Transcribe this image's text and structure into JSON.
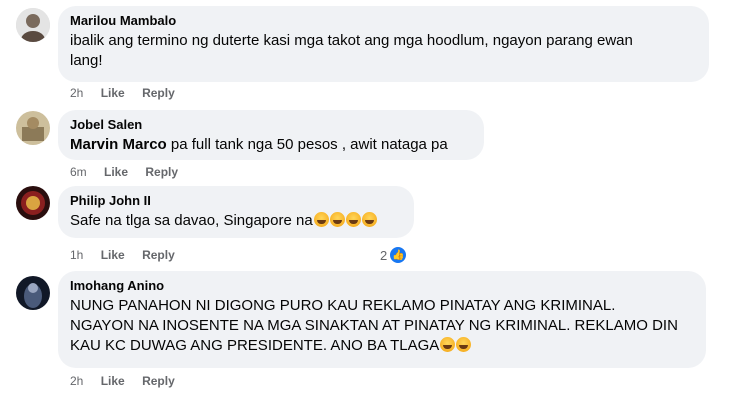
{
  "comments": [
    {
      "author": "Marilou Mambalo",
      "text_line1": "ibalik ang termino ng duterte kasi mga takot ang mga hoodlum, ngayon parang ewan",
      "text_line2": "lang!",
      "time": "2h",
      "like": "Like",
      "reply": "Reply",
      "avatar_color": "#c9c9c9"
    },
    {
      "author": "Jobel Salen",
      "mention": "Marvin Marco",
      "text": " pa full tank nga 50 pesos , awit nataga pa",
      "time": "6m",
      "like": "Like",
      "reply": "Reply",
      "avatar_color": "#b8a27a"
    },
    {
      "author": "Philip John II",
      "text": "Safe na tlga sa davao, Singapore na",
      "time": "1h",
      "like": "Like",
      "reply": "Reply",
      "reaction_count": "2",
      "reaction_icon": "like-icon",
      "avatar_color": "#3a1a1a"
    },
    {
      "author": "Imohang Anino",
      "text_line1": "NUNG PANAHON NI DIGONG PURO KAU REKLAMO PINATAY ANG KRIMINAL.",
      "text_line2": "NGAYON NA INOSENTE NA MGA SINAKTAN AT PINATAY NG KRIMINAL. REKLAMO DIN",
      "text_line3": "KAU KC DUWAG ANG PRESIDENTE. ANO BA TLAGA",
      "time": "2h",
      "like": "Like",
      "reply": "Reply",
      "avatar_color": "#1c2230"
    }
  ],
  "emoji_icon": "laughing-emoji-icon",
  "colors": {
    "bubble": "#f0f2f5",
    "meta": "#65676b",
    "like_badge": "#1877f2"
  }
}
